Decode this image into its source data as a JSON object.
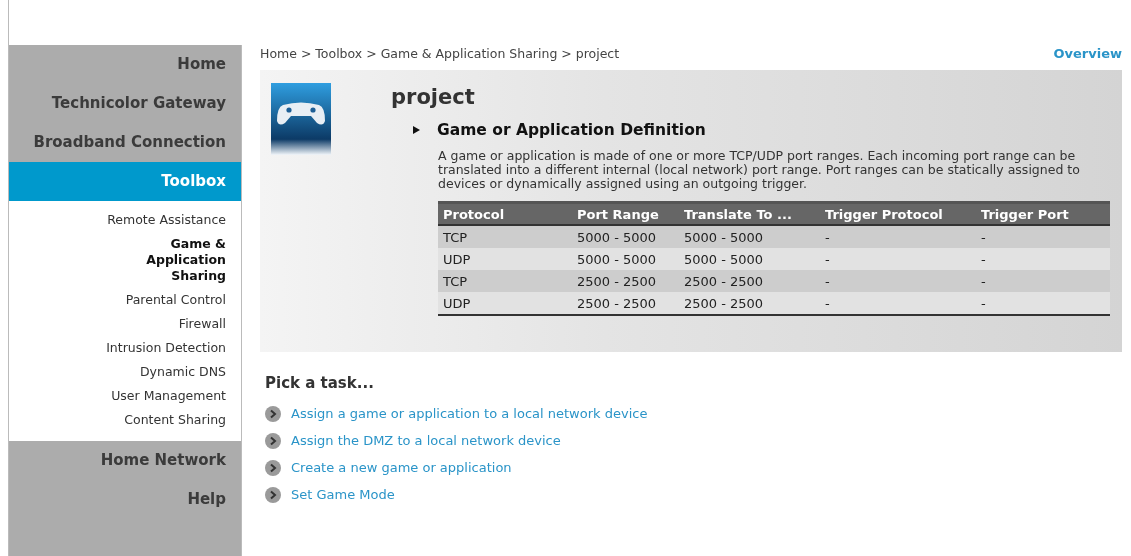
{
  "sidebar": {
    "items": [
      {
        "label": "Home",
        "selected": false
      },
      {
        "label": "Technicolor Gateway",
        "selected": false
      },
      {
        "label": "Broadband Connection",
        "selected": false
      },
      {
        "label": "Toolbox",
        "selected": true,
        "children": [
          {
            "label": "Remote Assistance",
            "selected": false
          },
          {
            "label": "Game & Application Sharing",
            "selected": true
          },
          {
            "label": "Parental Control",
            "selected": false
          },
          {
            "label": "Firewall",
            "selected": false
          },
          {
            "label": "Intrusion Detection",
            "selected": false
          },
          {
            "label": "Dynamic DNS",
            "selected": false
          },
          {
            "label": "User Management",
            "selected": false
          },
          {
            "label": "Content Sharing",
            "selected": false
          }
        ]
      },
      {
        "label": "Home Network",
        "selected": false
      },
      {
        "label": "Help",
        "selected": false
      }
    ]
  },
  "breadcrumb": "Home > Toolbox > Game & Application Sharing > project",
  "overview_link": "Overview",
  "page_title": "project",
  "section": {
    "title": "Game or Application Definition",
    "description": "A game or application is made of one or more TCP/UDP port ranges. Each incoming port range can be translated into a different internal (local network) port range. Port ranges can be statically assigned to devices or dynamically assigned using an outgoing trigger."
  },
  "table": {
    "columns": [
      "Protocol",
      "Port Range",
      "Translate To ...",
      "Trigger Protocol",
      "Trigger Port"
    ],
    "rows": [
      [
        "TCP",
        "5000 - 5000",
        "5000 - 5000",
        "-",
        "-"
      ],
      [
        "UDP",
        "5000 - 5000",
        "5000 - 5000",
        "-",
        "-"
      ],
      [
        "TCP",
        "2500 - 2500",
        "2500 - 2500",
        "-",
        "-"
      ],
      [
        "UDP",
        "2500 - 2500",
        "2500 - 2500",
        "-",
        "-"
      ]
    ]
  },
  "tasks": {
    "title": "Pick a task...",
    "items": [
      "Assign a game or application to a local network device",
      "Assign the DMZ to a local network device",
      "Create a new game or application",
      "Set Game Mode"
    ]
  }
}
